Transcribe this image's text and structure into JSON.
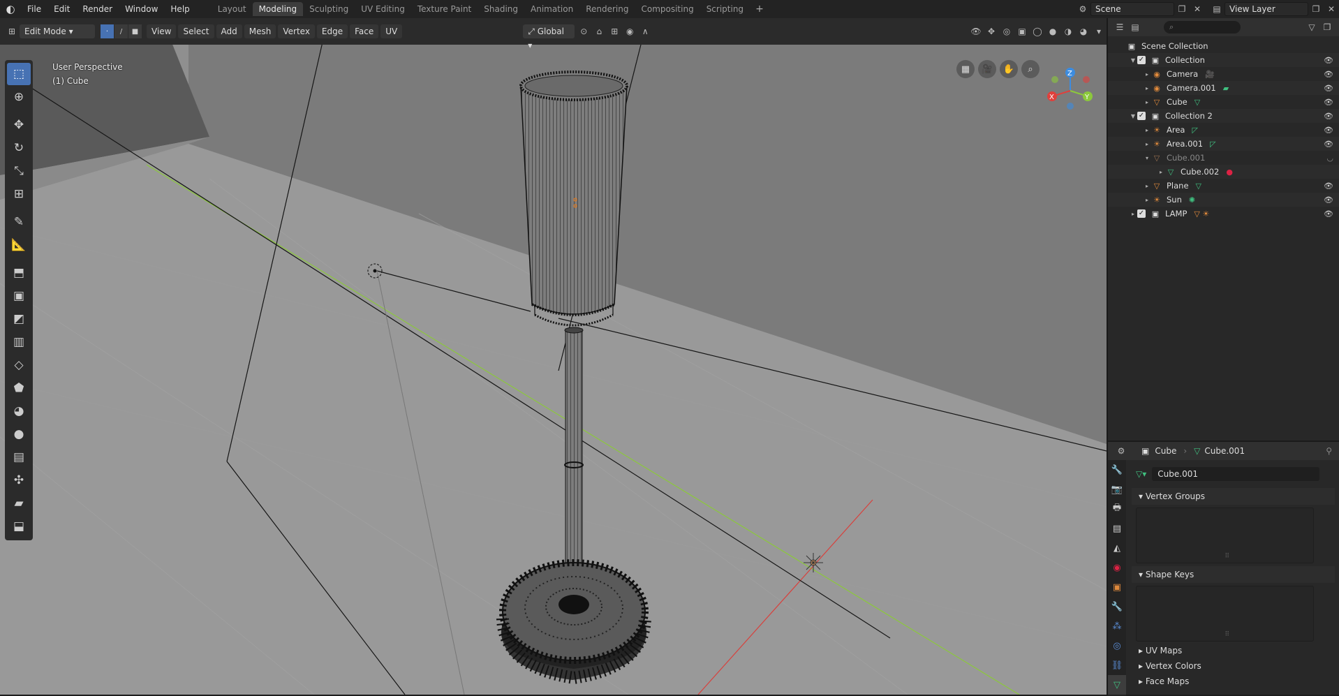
{
  "topbar": {
    "menu": [
      "File",
      "Edit",
      "Render",
      "Window",
      "Help"
    ],
    "tabs": [
      "Layout",
      "Modeling",
      "Sculpting",
      "UV Editing",
      "Texture Paint",
      "Shading",
      "Animation",
      "Rendering",
      "Compositing",
      "Scripting"
    ],
    "active_tab": "Modeling",
    "add_tab": "+",
    "scene": "Scene",
    "view_layer": "View Layer"
  },
  "viewport_header": {
    "mode": "Edit Mode",
    "menus": [
      "View",
      "Select",
      "Add",
      "Mesh",
      "Vertex",
      "Edge",
      "Face",
      "UV"
    ],
    "orientation": "Global",
    "options": "Options"
  },
  "viewport": {
    "perspective": "User Perspective",
    "object": "(1) Cube",
    "gizmo": {
      "z": "Z",
      "y": "Y",
      "x": "X"
    }
  },
  "outliner": {
    "rows": [
      {
        "label": "Scene Collection",
        "indent": 0,
        "type": "scene"
      },
      {
        "label": "Collection",
        "indent": 1,
        "type": "collection",
        "expanded": true
      },
      {
        "label": "Camera",
        "indent": 2,
        "type": "camera"
      },
      {
        "label": "Camera.001",
        "indent": 2,
        "type": "camera"
      },
      {
        "label": "Cube",
        "indent": 2,
        "type": "mesh"
      },
      {
        "label": "Collection 2",
        "indent": 1,
        "type": "collection",
        "expanded": true
      },
      {
        "label": "Area",
        "indent": 2,
        "type": "light"
      },
      {
        "label": "Area.001",
        "indent": 2,
        "type": "light"
      },
      {
        "label": "Cube.001",
        "indent": 2,
        "type": "mesh",
        "dim": true
      },
      {
        "label": "Cube.002",
        "indent": 3,
        "type": "meshdata"
      },
      {
        "label": "Plane",
        "indent": 2,
        "type": "mesh"
      },
      {
        "label": "Sun",
        "indent": 2,
        "type": "light"
      },
      {
        "label": "LAMP",
        "indent": 1,
        "type": "collection"
      }
    ]
  },
  "properties": {
    "object": "Cube",
    "data": "Cube.001",
    "mesh_name": "Cube.001",
    "sections": {
      "vertex_groups": "Vertex Groups",
      "shape_keys": "Shape Keys",
      "uv_maps": "UV Maps",
      "vertex_colors": "Vertex Colors",
      "face_maps": "Face Maps"
    }
  },
  "colors": {
    "accent": "#4772b3",
    "viewport_bg": "#8f8f8f",
    "x_axis": "#e0403c",
    "y_axis": "#8cc83c",
    "z_axis": "#3c8ce0"
  }
}
